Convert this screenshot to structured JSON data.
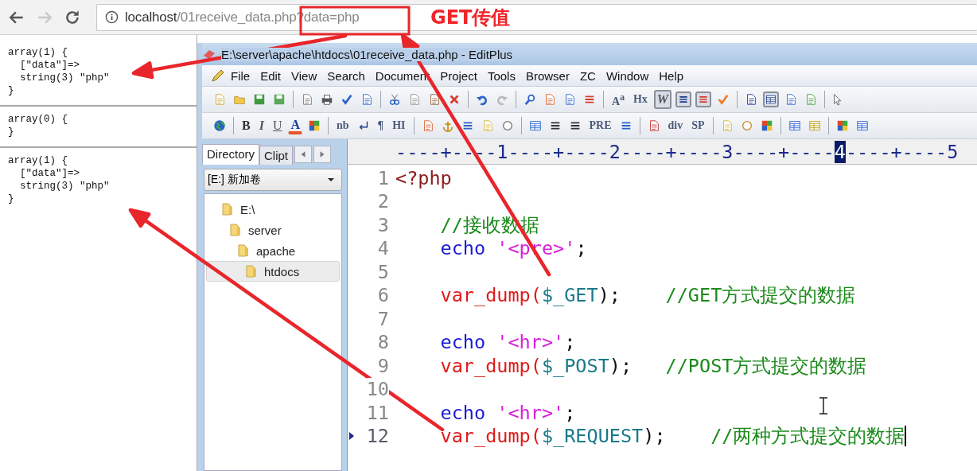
{
  "browser": {
    "forward_disabled": true,
    "url_host": "localhost",
    "url_path": "/01receive_data.php?data=php"
  },
  "annotation": {
    "label": "GET传值"
  },
  "output": [
    {
      "lines": [
        "array(1) {",
        "  [\"data\"]=>",
        "  string(3) \"php\"",
        "}"
      ]
    },
    {
      "lines": [
        "array(0) {",
        "}"
      ]
    },
    {
      "lines": [
        "array(1) {",
        "  [\"data\"]=>",
        "  string(3) \"php\"",
        "}"
      ]
    }
  ],
  "editplus": {
    "title": "E:\\server\\apache\\htdocs\\01receive_data.php - EditPlus",
    "menu": [
      "File",
      "Edit",
      "View",
      "Search",
      "Document",
      "Project",
      "Tools",
      "Browser",
      "ZC",
      "Window",
      "Help"
    ],
    "toolbar_1": [
      {
        "kind": "icon",
        "pressed": false
      },
      {
        "kind": "icon",
        "pressed": false
      },
      {
        "kind": "icon",
        "pressed": false
      },
      {
        "kind": "icon",
        "pressed": false
      },
      {
        "kind": "separator"
      },
      {
        "kind": "icon",
        "pressed": false
      },
      {
        "kind": "icon",
        "pressed": false
      },
      {
        "kind": "icon",
        "pressed": false
      },
      {
        "kind": "icon",
        "pressed": false
      },
      {
        "kind": "separator"
      },
      {
        "kind": "icon",
        "pressed": false
      },
      {
        "kind": "icon",
        "pressed": false
      },
      {
        "kind": "icon",
        "pressed": false
      },
      {
        "kind": "icon",
        "pressed": false
      },
      {
        "kind": "separator"
      },
      {
        "kind": "icon",
        "pressed": false
      },
      {
        "kind": "icon",
        "pressed": false
      },
      {
        "kind": "separator"
      },
      {
        "kind": "icon",
        "pressed": false
      },
      {
        "kind": "icon",
        "pressed": false
      },
      {
        "kind": "icon",
        "pressed": false
      },
      {
        "kind": "icon",
        "pressed": false
      },
      {
        "kind": "separator"
      },
      {
        "kind": "text",
        "label": "A$^{a}$",
        "pressed": false
      },
      {
        "kind": "text",
        "label": "Hx",
        "pressed": false
      },
      {
        "kind": "italic",
        "label": "W",
        "pressed": true
      },
      {
        "kind": "icon",
        "pressed": true
      },
      {
        "kind": "icon",
        "pressed": true
      },
      {
        "kind": "icon",
        "pressed": false
      },
      {
        "kind": "separator"
      },
      {
        "kind": "icon",
        "pressed": false
      },
      {
        "kind": "icon",
        "pressed": true
      },
      {
        "kind": "icon",
        "pressed": false
      },
      {
        "kind": "icon",
        "pressed": false
      },
      {
        "kind": "separator"
      },
      {
        "kind": "icon",
        "pressed": false
      }
    ],
    "toolbar_2": [
      {
        "kind": "icon",
        "pressed": false
      },
      {
        "kind": "separator"
      },
      {
        "kind": "bold",
        "label": "B",
        "pressed": false
      },
      {
        "kind": "italic",
        "label": "I",
        "pressed": false
      },
      {
        "kind": "underline",
        "label": "U",
        "pressed": false
      },
      {
        "kind": "color-letter",
        "label": "A",
        "pressed": false
      },
      {
        "kind": "icon",
        "pressed": false
      },
      {
        "kind": "separator"
      },
      {
        "kind": "text",
        "label": "nb",
        "pressed": false
      },
      {
        "kind": "icon",
        "pressed": false
      },
      {
        "kind": "text",
        "label": "¶",
        "pressed": false
      },
      {
        "kind": "text",
        "label": "HI",
        "pressed": false
      },
      {
        "kind": "separator"
      },
      {
        "kind": "icon",
        "pressed": false
      },
      {
        "kind": "icon",
        "pressed": false
      },
      {
        "kind": "icon",
        "pressed": false
      },
      {
        "kind": "icon",
        "pressed": false
      },
      {
        "kind": "icon",
        "pressed": false
      },
      {
        "kind": "separator"
      },
      {
        "kind": "icon",
        "pressed": false
      },
      {
        "kind": "icon",
        "pressed": false
      },
      {
        "kind": "icon",
        "pressed": false
      },
      {
        "kind": "text",
        "label": "PRE",
        "pressed": false
      },
      {
        "kind": "icon",
        "pressed": false
      },
      {
        "kind": "separator"
      },
      {
        "kind": "icon",
        "pressed": false
      },
      {
        "kind": "text",
        "label": "div",
        "pressed": false
      },
      {
        "kind": "text",
        "label": "SP",
        "pressed": false
      },
      {
        "kind": "separator"
      },
      {
        "kind": "icon",
        "pressed": false
      },
      {
        "kind": "icon",
        "pressed": false
      },
      {
        "kind": "icon",
        "pressed": false
      },
      {
        "kind": "separator"
      },
      {
        "kind": "icon",
        "pressed": false
      },
      {
        "kind": "icon",
        "pressed": false
      },
      {
        "kind": "separator"
      },
      {
        "kind": "icon",
        "pressed": false
      },
      {
        "kind": "icon",
        "pressed": false
      }
    ]
  },
  "directory": {
    "tabs": [
      {
        "label": "Directory",
        "selected": true
      },
      {
        "label": "Clipt",
        "selected": false
      }
    ],
    "drive": "[E:] 新加卷",
    "tree": [
      {
        "label": "E:\\",
        "selected": false,
        "children": [
          {
            "label": "server",
            "selected": false,
            "children": [
              {
                "label": "apache",
                "selected": false,
                "children": [
                  {
                    "label": "htdocs",
                    "selected": true
                  }
                ]
              }
            ]
          }
        ]
      }
    ]
  },
  "editor": {
    "ruler": {
      "before": "----+----1----+----2----+----3----+----",
      "marked": "4",
      "after": "----+----5"
    },
    "lines": [
      {
        "number": "1",
        "current": false,
        "indent": false,
        "tokens": [
          {
            "kind": "tag",
            "text": "<?php"
          }
        ]
      },
      {
        "number": "2",
        "current": false
      },
      {
        "number": "3",
        "current": false,
        "indent": true,
        "tokens": [
          {
            "kind": "comment",
            "text": "//接收数据"
          }
        ]
      },
      {
        "number": "4",
        "current": false,
        "indent": true,
        "tokens": [
          {
            "kind": "keyword",
            "text": "echo "
          },
          {
            "kind": "string",
            "text": "'<pre>'"
          },
          {
            "kind": "plain",
            "text": ";"
          }
        ]
      },
      {
        "number": "5",
        "current": false
      },
      {
        "number": "6",
        "current": false,
        "indent": true,
        "tokens": [
          {
            "kind": "function",
            "text": "var_dump("
          },
          {
            "kind": "variable",
            "text": "$_GET"
          },
          {
            "kind": "plain",
            "text": ");"
          },
          {
            "kind": "comment",
            "text": "//GET方式提交的数据"
          }
        ]
      },
      {
        "number": "7",
        "current": false
      },
      {
        "number": "8",
        "current": false,
        "indent": true,
        "tokens": [
          {
            "kind": "keyword",
            "text": "echo "
          },
          {
            "kind": "string",
            "text": "'<hr>'"
          },
          {
            "kind": "plain",
            "text": ";"
          }
        ]
      },
      {
        "number": "9",
        "current": false,
        "indent": true,
        "tokens": [
          {
            "kind": "function",
            "text": "var_dump("
          },
          {
            "kind": "variable",
            "text": "$_POST"
          },
          {
            "kind": "plain",
            "text": ");"
          },
          {
            "kind": "comment",
            "text": "//POST方式提交的数据"
          }
        ]
      },
      {
        "number": "10",
        "current": false
      },
      {
        "number": "11",
        "current": false,
        "indent": true,
        "tokens": [
          {
            "kind": "keyword",
            "text": "echo "
          },
          {
            "kind": "string",
            "text": "'<hr>'"
          },
          {
            "kind": "plain",
            "text": ";"
          }
        ]
      },
      {
        "number": "12",
        "current": true,
        "indent": true,
        "tokens": [
          {
            "kind": "function",
            "text": "var_dump("
          },
          {
            "kind": "variable",
            "text": "$_REQUEST"
          },
          {
            "kind": "plain",
            "text": ");"
          },
          {
            "kind": "comment",
            "text": "//两种方式提交的数据"
          }
        ]
      }
    ]
  }
}
